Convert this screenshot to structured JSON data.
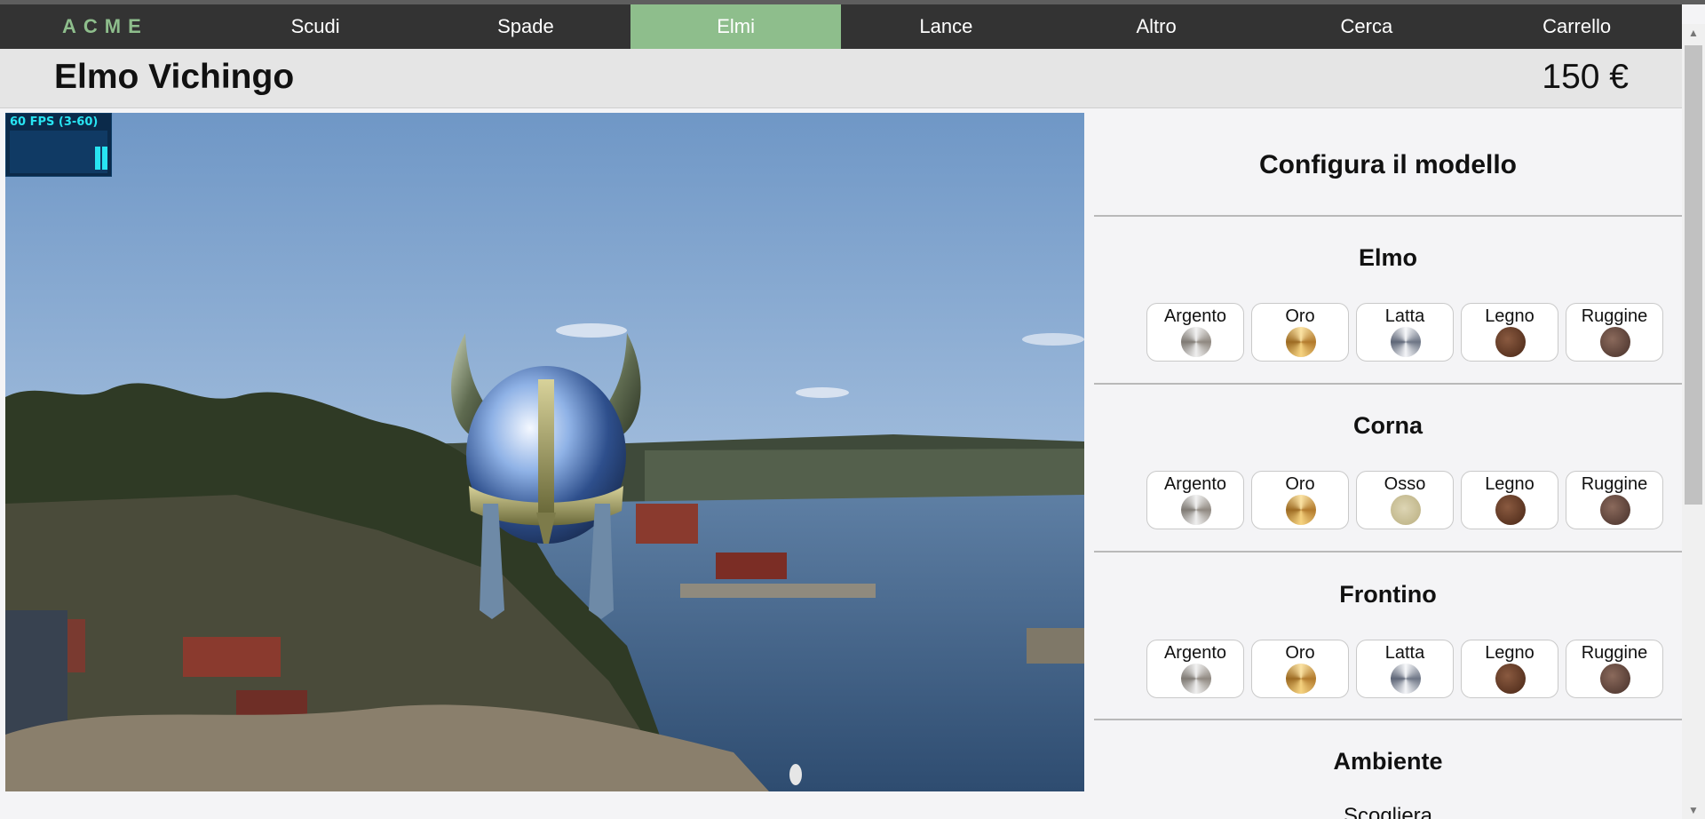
{
  "nav": {
    "logo": "ACME",
    "items": [
      {
        "label": "Scudi",
        "active": false
      },
      {
        "label": "Spade",
        "active": false
      },
      {
        "label": "Elmi",
        "active": true
      },
      {
        "label": "Lance",
        "active": false
      },
      {
        "label": "Altro",
        "active": false
      },
      {
        "label": "Cerca",
        "active": false
      },
      {
        "label": "Carrello",
        "active": false
      }
    ],
    "colors": {
      "bar": "#333333",
      "active": "#8ebe8c",
      "logo": "#8ebe8c"
    }
  },
  "product": {
    "title": "Elmo Vichingo",
    "price": "150 €"
  },
  "viewer": {
    "fps_label": "60 FPS (3-60)"
  },
  "config": {
    "title": "Configura il modello",
    "sections": [
      {
        "title": "Elmo",
        "options": [
          "Argento",
          "Oro",
          "Latta",
          "Legno",
          "Ruggine"
        ]
      },
      {
        "title": "Corna",
        "options": [
          "Argento",
          "Oro",
          "Osso",
          "Legno",
          "Ruggine"
        ]
      },
      {
        "title": "Frontino",
        "options": [
          "Argento",
          "Oro",
          "Latta",
          "Legno",
          "Ruggine"
        ]
      }
    ],
    "environment": {
      "title": "Ambiente",
      "selected": "Scogliera"
    }
  }
}
